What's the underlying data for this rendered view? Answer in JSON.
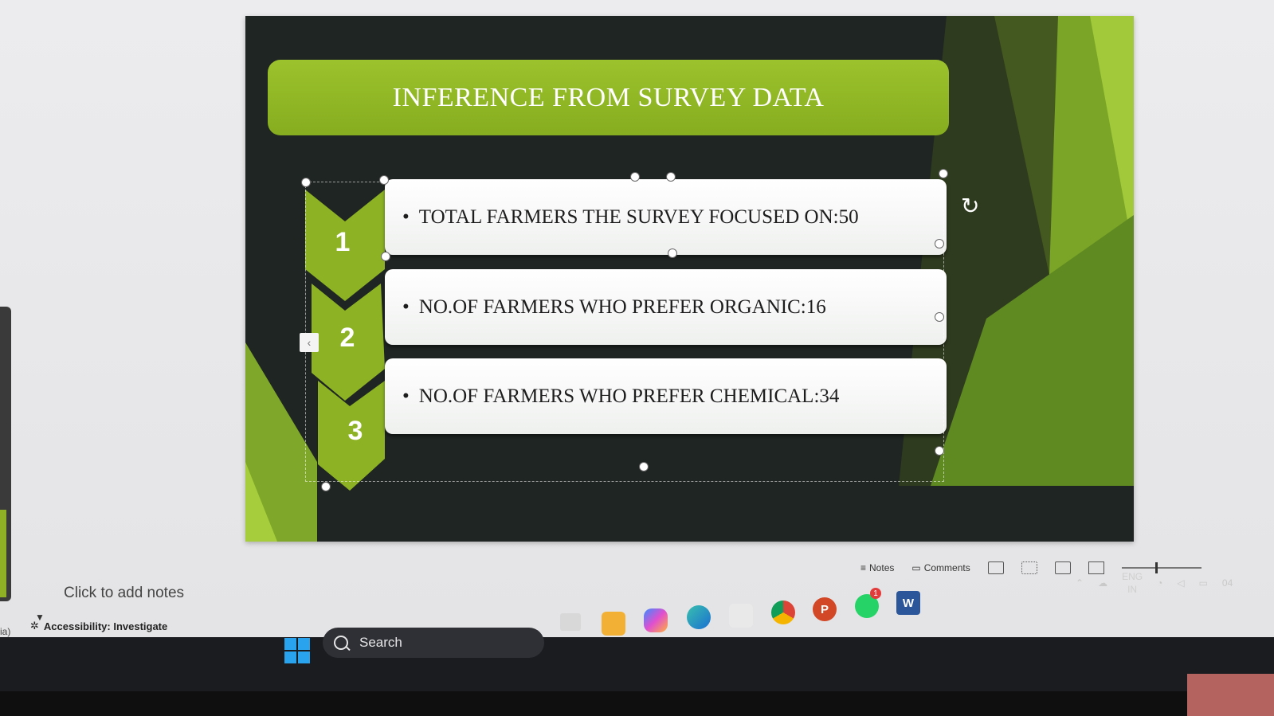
{
  "slide": {
    "title": "INFERENCE FROM SURVEY DATA",
    "rows": [
      {
        "number": "1",
        "bullet": "•",
        "text": "TOTAL FARMERS THE SURVEY FOCUSED ON:50"
      },
      {
        "number": "2",
        "bullet": "•",
        "text": "NO.OF FARMERS WHO PREFER ORGANIC:16"
      },
      {
        "number": "3",
        "bullet": "•",
        "text": "NO.OF FARMERS WHO PREFER CHEMICAL:34"
      }
    ],
    "colors": {
      "accent": "#8fb824",
      "background": "#1f2522",
      "row": "#ffffff"
    }
  },
  "notes": {
    "placeholder": "Click to add notes"
  },
  "status_bar": {
    "left_fragment": "ia)",
    "accessibility": "Accessibility: Investigate",
    "notes_label": "Notes",
    "comments_label": "Comments"
  },
  "taskbar": {
    "search_label": "Search",
    "lang_top": "ENG",
    "lang_bottom": "IN",
    "whatsapp_badge": "1",
    "clock_fragment": "04"
  },
  "icons": {
    "start": "windows-start-icon",
    "search": "search-icon",
    "taskview": "task-view-icon",
    "explorer": "file-explorer-icon",
    "copilot": "copilot-icon",
    "edge": "edge-icon",
    "store": "store-icon",
    "chrome": "chrome-icon",
    "powerpoint": "powerpoint-icon",
    "whatsapp": "whatsapp-icon",
    "word": "word-icon"
  }
}
